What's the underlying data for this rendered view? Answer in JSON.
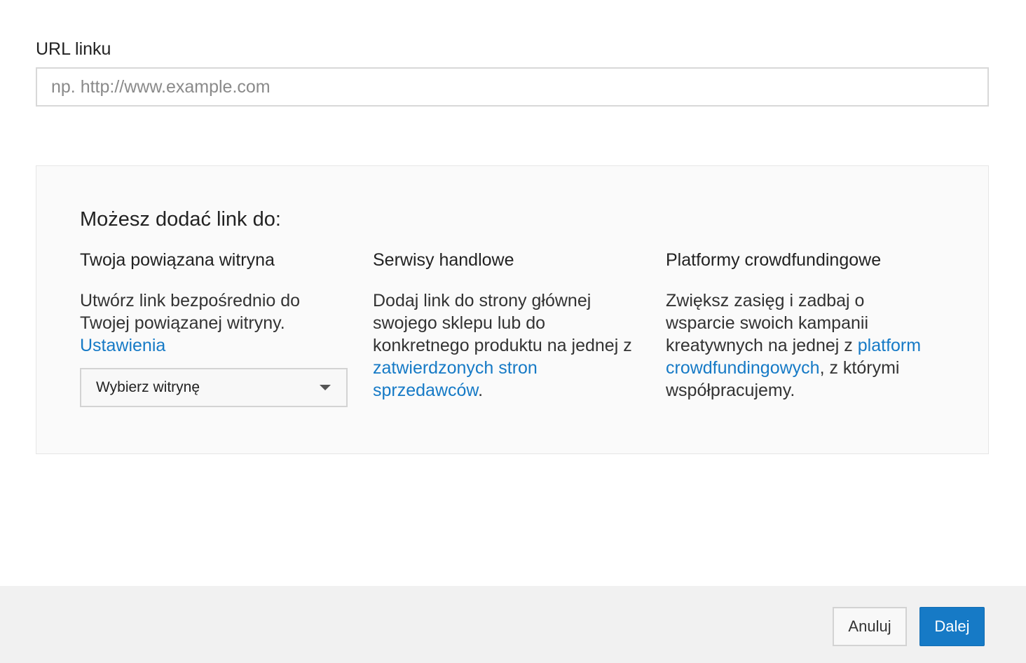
{
  "url_section": {
    "label": "URL linku",
    "placeholder": "np. http://www.example.com",
    "value": ""
  },
  "info_panel": {
    "title": "Możesz dodać link do:",
    "columns": [
      {
        "heading": "Twoja powiązana witryna",
        "text_before": "Utwórz link bezpośrednio do Twojej powiązanej witryny.",
        "link_text": "Ustawienia",
        "select_label": "Wybierz witrynę"
      },
      {
        "heading": "Serwisy handlowe",
        "text_before": "Dodaj link do strony głównej swojego sklepu lub do konkretnego produktu na jednej z ",
        "link_text": "zatwierdzonych stron sprzedawców",
        "text_after": "."
      },
      {
        "heading": "Platformy crowdfundingowe",
        "text_before": "Zwiększ zasięg i zadbaj o wsparcie swoich kampanii kreatywnych na jednej z ",
        "link_text": "platform crowdfundingowych",
        "text_after": ", z którymi współpracujemy."
      }
    ]
  },
  "footer": {
    "cancel_label": "Anuluj",
    "next_label": "Dalej"
  },
  "colors": {
    "link": "#167ac6",
    "primary_button": "#167ac6",
    "footer_bg": "#f1f1f1",
    "panel_bg": "#fafafa"
  },
  "icons": {
    "select_caret": "caret-down-icon"
  }
}
